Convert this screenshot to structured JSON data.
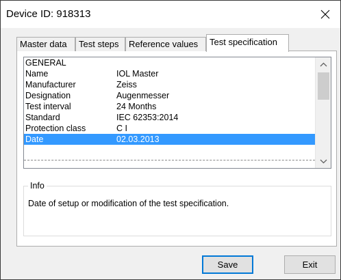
{
  "window": {
    "title": "Device ID: 918313",
    "close_glyph": "✕"
  },
  "tabs": [
    {
      "label": "Master data",
      "active": false
    },
    {
      "label": "Test steps",
      "active": false
    },
    {
      "label": "Reference values",
      "active": false
    },
    {
      "label": "Test specification",
      "active": true
    }
  ],
  "spec_list": {
    "rows": [
      {
        "key": "GENERAL",
        "value": ""
      },
      {
        "key": "Name",
        "value": "IOL Master"
      },
      {
        "key": "Manufacturer",
        "value": "Zeiss"
      },
      {
        "key": "Designation",
        "value": "Augenmesser"
      },
      {
        "key": "Test interval",
        "value": "24 Months"
      },
      {
        "key": "Standard",
        "value": "IEC 62353:2014"
      },
      {
        "key": "Protection class",
        "value": "C I"
      },
      {
        "key": "Date",
        "value": "02.03.2013",
        "selected": true
      }
    ],
    "scrollbar": {
      "up_icon": "chevron-up-icon",
      "down_icon": "chevron-down-icon"
    }
  },
  "info": {
    "label": "Info",
    "text": "Date of setup or modification of the test specification."
  },
  "buttons": {
    "save": "Save",
    "exit": "Exit"
  },
  "colors": {
    "selection": "#3399ff",
    "selection_text": "#ffffff",
    "default_button_border": "#0078d7"
  }
}
